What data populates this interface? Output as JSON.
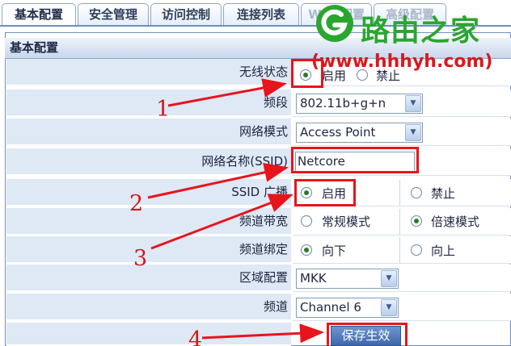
{
  "tabs": [
    {
      "label": "基本配置"
    },
    {
      "label": "安全管理"
    },
    {
      "label": "访问控制"
    },
    {
      "label": "连接列表"
    },
    {
      "label": "WDS配置"
    },
    {
      "label": "高级配置"
    }
  ],
  "panel": {
    "title": "基本配置"
  },
  "rows": {
    "wireless_status": {
      "label": "无线状态",
      "options": [
        "启用",
        "禁止"
      ],
      "selected": "启用"
    },
    "band": {
      "label": "频段",
      "value": "802.11b+g+n"
    },
    "network_mode": {
      "label": "网络模式",
      "value": "Access Point"
    },
    "ssid": {
      "label": "网络名称(SSID)",
      "value": "Netcore"
    },
    "ssid_broadcast": {
      "label": "SSID 广播",
      "options": [
        "启用",
        "禁止"
      ],
      "selected": "启用"
    },
    "bandwidth": {
      "label": "频道带宽",
      "options": [
        "常规模式",
        "倍速模式"
      ],
      "selected": "倍速模式"
    },
    "channel_binding": {
      "label": "频道绑定",
      "options": [
        "向下",
        "向上"
      ],
      "selected": "向下"
    },
    "region": {
      "label": "区域配置",
      "value": "MKK"
    },
    "channel": {
      "label": "频道",
      "value": "Channel 6"
    }
  },
  "save_button": {
    "label": "保存生效"
  },
  "annotations": {
    "markers": [
      "1",
      "2",
      "3",
      "4"
    ],
    "color": "#e8141c"
  },
  "watermark": {
    "name": "路由之家",
    "url": "(www.hhhyh.com)",
    "name_color": "#2aa62f",
    "url_color": "#d8191e"
  },
  "colors": {
    "label_bg": "#dfe8f5",
    "border": "#6e8fc0",
    "button": "#3d68ad"
  }
}
